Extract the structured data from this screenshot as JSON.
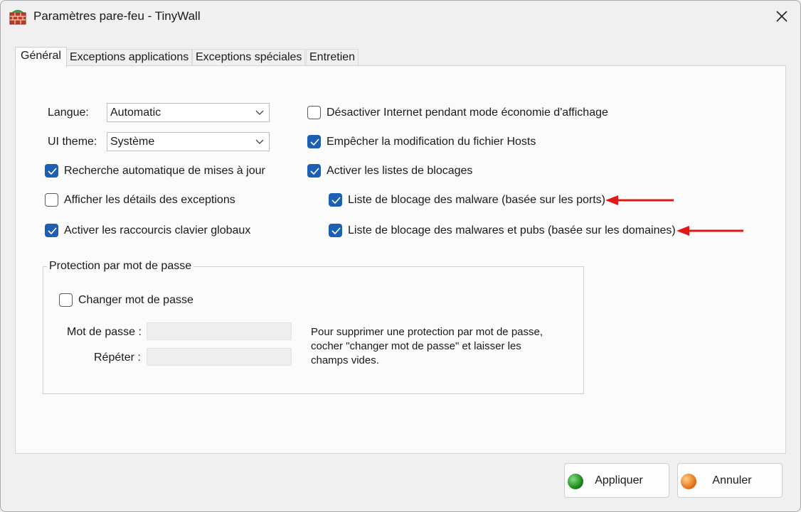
{
  "window": {
    "title": "Paramètres pare-feu - TinyWall",
    "icon": "brick-firewall-icon"
  },
  "tabs": [
    {
      "label": "Général",
      "active": true
    },
    {
      "label": "Exceptions applications",
      "active": false
    },
    {
      "label": "Exceptions spéciales",
      "active": false
    },
    {
      "label": "Entretien",
      "active": false
    }
  ],
  "general": {
    "language": {
      "label": "Langue:",
      "value": "Automatic"
    },
    "ui_theme": {
      "label": "UI theme:",
      "value": "Système"
    },
    "left_checkboxes": [
      {
        "label": "Recherche automatique de mises à jour",
        "checked": true
      },
      {
        "label": "Afficher les détails des exceptions",
        "checked": false
      },
      {
        "label": "Activer les raccourcis clavier globaux",
        "checked": true
      }
    ],
    "right_checkboxes": [
      {
        "label": "Désactiver Internet pendant mode économie d'affichage",
        "checked": false
      },
      {
        "label": "Empêcher la modification du fichier Hosts",
        "checked": true
      },
      {
        "label": "Activer les listes de blocages",
        "checked": true
      },
      {
        "label": "Liste de blocage des malware (basée sur les ports)",
        "checked": true
      },
      {
        "label": "Liste de blocage des malwares et pubs (basée sur les domaines)",
        "checked": true
      }
    ],
    "password_group": {
      "title": "Protection par mot de passe",
      "change_checkbox": {
        "label": "Changer mot de passe",
        "checked": false
      },
      "password_label": "Mot de passe :",
      "repeat_label": "Répéter :",
      "password_value": "",
      "repeat_value": "",
      "hint_lines": [
        "Pour supprimer une protection par mot de passe,",
        "cocher \"changer mot de passe\" et laisser les",
        "champs vides."
      ]
    }
  },
  "buttons": {
    "apply": {
      "label": "Appliquer",
      "dot_color": "#1f8a1f"
    },
    "cancel": {
      "label": "Annuler",
      "dot_color": "#e8751a"
    }
  },
  "colors": {
    "checkbox_checked": "#1c5fb3",
    "annotation_arrow": "#e01818"
  }
}
